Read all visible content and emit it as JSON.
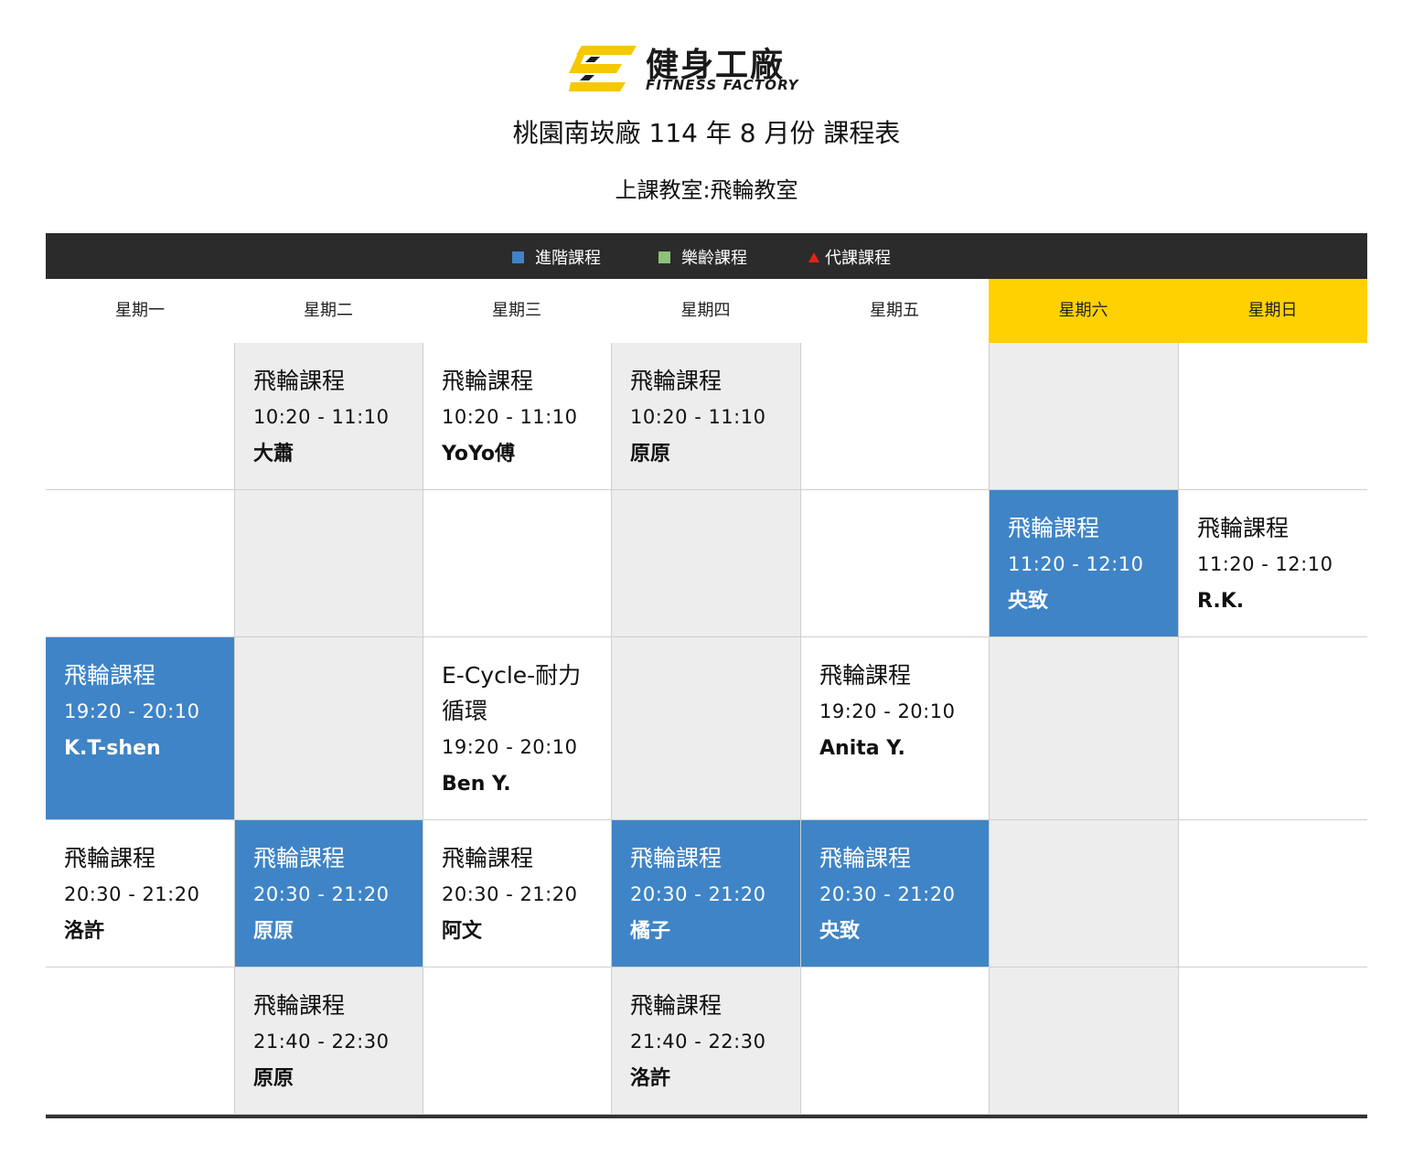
{
  "brand": {
    "name_cn": "健身工廠",
    "name_en": "FITNESS FACTORY",
    "logo_color": "#f5c800"
  },
  "title": "桃園南崁廠 114 年 8 月份 課程表",
  "subtitle": "上課教室:飛輪教室",
  "legend": [
    {
      "label": "進階課程",
      "marker": "square",
      "color": "#3f84c6"
    },
    {
      "label": "樂齡課程",
      "marker": "square",
      "color": "#8cc17a"
    },
    {
      "label": "代課課程",
      "marker": "triangle",
      "color": "#e0241b"
    }
  ],
  "days": [
    "星期一",
    "星期二",
    "星期三",
    "星期四",
    "星期五",
    "星期六",
    "星期日"
  ],
  "colors": {
    "advanced": "#3f84c6",
    "weekend_header": "#ffd100",
    "grey_cell": "#ededed",
    "legend_bar": "#2b2b2b"
  },
  "schedule": [
    [
      {
        "bg": "white"
      },
      {
        "bg": "grey",
        "name": "飛輪課程",
        "time": "10:20 - 11:10",
        "coach": "大蕭"
      },
      {
        "bg": "white",
        "name": "飛輪課程",
        "time": "10:20 - 11:10",
        "coach": "YoYo傅"
      },
      {
        "bg": "grey",
        "name": "飛輪課程",
        "time": "10:20 - 11:10",
        "coach": "原原"
      },
      {
        "bg": "white"
      },
      {
        "bg": "grey"
      },
      {
        "bg": "white"
      }
    ],
    [
      {
        "bg": "white"
      },
      {
        "bg": "grey"
      },
      {
        "bg": "white"
      },
      {
        "bg": "grey"
      },
      {
        "bg": "white"
      },
      {
        "bg": "blue",
        "name": "飛輪課程",
        "time": "11:20 - 12:10",
        "coach": "央致"
      },
      {
        "bg": "white",
        "name": "飛輪課程",
        "time": "11:20 - 12:10",
        "coach": "R.K."
      }
    ],
    [
      {
        "bg": "blue",
        "name": "飛輪課程",
        "time": "19:20 - 20:10",
        "coach": "K.T-shen"
      },
      {
        "bg": "grey"
      },
      {
        "bg": "white",
        "name": "E-Cycle-耐力循環",
        "time": "19:20 - 20:10",
        "coach": "Ben Y."
      },
      {
        "bg": "grey"
      },
      {
        "bg": "white",
        "name": "飛輪課程",
        "time": "19:20 - 20:10",
        "coach": "Anita Y."
      },
      {
        "bg": "grey"
      },
      {
        "bg": "white"
      }
    ],
    [
      {
        "bg": "white",
        "name": "飛輪課程",
        "time": "20:30 - 21:20",
        "coach": "洛許"
      },
      {
        "bg": "blue",
        "name": "飛輪課程",
        "time": "20:30 - 21:20",
        "coach": "原原"
      },
      {
        "bg": "white",
        "name": "飛輪課程",
        "time": "20:30 - 21:20",
        "coach": "阿文"
      },
      {
        "bg": "blue",
        "name": "飛輪課程",
        "time": "20:30 - 21:20",
        "coach": "橘子"
      },
      {
        "bg": "blue",
        "name": "飛輪課程",
        "time": "20:30 - 21:20",
        "coach": "央致"
      },
      {
        "bg": "grey"
      },
      {
        "bg": "white"
      }
    ],
    [
      {
        "bg": "white"
      },
      {
        "bg": "grey",
        "name": "飛輪課程",
        "time": "21:40 - 22:30",
        "coach": "原原"
      },
      {
        "bg": "white"
      },
      {
        "bg": "grey",
        "name": "飛輪課程",
        "time": "21:40 - 22:30",
        "coach": "洛許"
      },
      {
        "bg": "white"
      },
      {
        "bg": "grey"
      },
      {
        "bg": "white"
      }
    ]
  ]
}
